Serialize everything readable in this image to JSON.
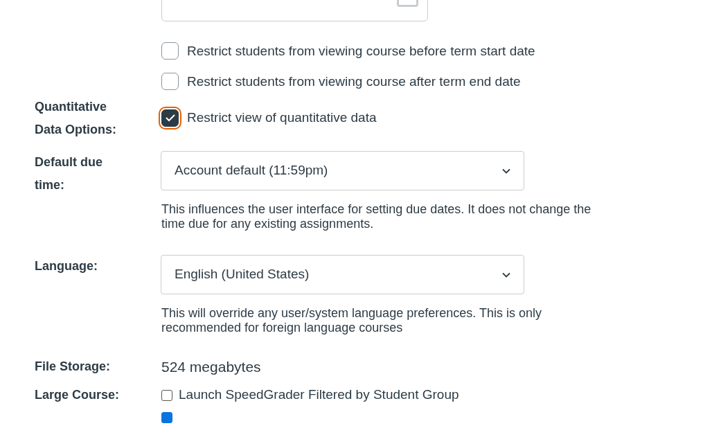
{
  "term_restrictions": [
    {
      "label": "Restrict students from viewing course before term start date",
      "checked": false
    },
    {
      "label": "Restrict students from viewing course after term end date",
      "checked": false
    }
  ],
  "settings": [
    {
      "kind": "checkbox",
      "label": "Quantitative Data Options:",
      "option": "Restrict view of quantitative data",
      "checked": true,
      "focused": true
    },
    {
      "kind": "select",
      "label": "Default due time:",
      "value": "Account default (11:59pm)",
      "help": "This influences the user interface for setting due dates. It does not change the time due for any existing assignments."
    },
    {
      "kind": "select",
      "label": "Language:",
      "value": "English (United States)",
      "help": "This will override any user/system language preferences. This is only recommended for foreign language courses"
    },
    {
      "kind": "text",
      "label": "File Storage:",
      "value": "524 megabytes"
    },
    {
      "kind": "small-checkbox",
      "label": "Large Course:",
      "option": "Launch SpeedGrader Filtered by Student Group",
      "checked": false
    },
    {
      "kind": "small-checkbox",
      "checked": true
    }
  ]
}
